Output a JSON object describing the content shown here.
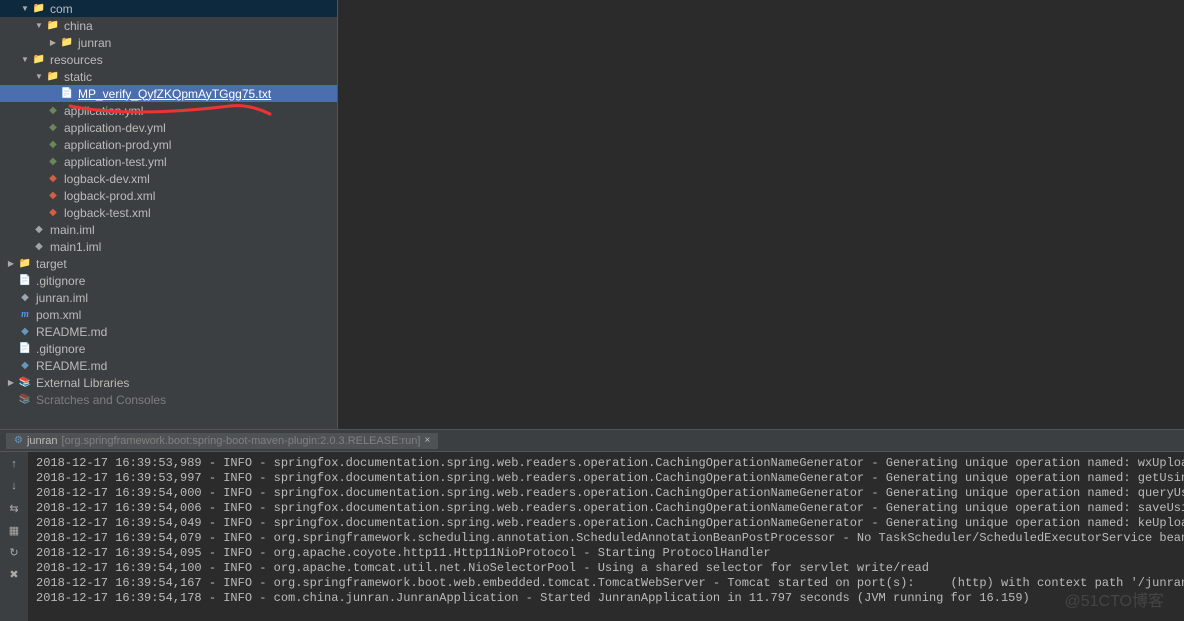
{
  "tree": [
    {
      "indent": 1,
      "arrow": "▼",
      "icon": "folder",
      "label": "com"
    },
    {
      "indent": 2,
      "arrow": "▼",
      "icon": "folder",
      "label": "china"
    },
    {
      "indent": 3,
      "arrow": "▶",
      "icon": "folder",
      "label": "junran"
    },
    {
      "indent": 1,
      "arrow": "▼",
      "icon": "folder-res",
      "label": "resources"
    },
    {
      "indent": 2,
      "arrow": "▼",
      "icon": "folder",
      "label": "static"
    },
    {
      "indent": 3,
      "arrow": "",
      "icon": "file",
      "label": "MP_verify_QyfZKQpmAyTGgg75.txt",
      "selected": true
    },
    {
      "indent": 2,
      "arrow": "",
      "icon": "yml",
      "label": "application.yml"
    },
    {
      "indent": 2,
      "arrow": "",
      "icon": "yml",
      "label": "application-dev.yml"
    },
    {
      "indent": 2,
      "arrow": "",
      "icon": "yml",
      "label": "application-prod.yml"
    },
    {
      "indent": 2,
      "arrow": "",
      "icon": "yml",
      "label": "application-test.yml"
    },
    {
      "indent": 2,
      "arrow": "",
      "icon": "xml",
      "label": "logback-dev.xml"
    },
    {
      "indent": 2,
      "arrow": "",
      "icon": "xml",
      "label": "logback-prod.xml"
    },
    {
      "indent": 2,
      "arrow": "",
      "icon": "xml",
      "label": "logback-test.xml"
    },
    {
      "indent": 1,
      "arrow": "",
      "icon": "iml",
      "label": "main.iml"
    },
    {
      "indent": 1,
      "arrow": "",
      "icon": "iml",
      "label": "main1.iml"
    },
    {
      "indent": 0,
      "arrow": "▶",
      "icon": "folder-target",
      "label": "target"
    },
    {
      "indent": 0,
      "arrow": "",
      "icon": "file",
      "label": ".gitignore"
    },
    {
      "indent": 0,
      "arrow": "",
      "icon": "iml",
      "label": "junran.iml"
    },
    {
      "indent": 0,
      "arrow": "",
      "icon": "m",
      "label": "pom.xml"
    },
    {
      "indent": 0,
      "arrow": "",
      "icon": "md",
      "label": "README.md"
    },
    {
      "indent": 0,
      "arrow": "",
      "icon": "file",
      "label": ".gitignore",
      "noindent": true
    },
    {
      "indent": 0,
      "arrow": "",
      "icon": "md",
      "label": "README.md",
      "noindent": true
    },
    {
      "indent": 0,
      "arrow": "▶",
      "icon": "ext",
      "label": "External Libraries",
      "noindent": true
    },
    {
      "indent": 0,
      "arrow": "",
      "icon": "ext",
      "label": "Scratches and Consoles",
      "noindent": true,
      "cut": true
    }
  ],
  "consoleTab": {
    "name": "junran",
    "detail": "[org.springframework.boot:spring-boot-maven-plugin:2.0.3.RELEASE:run]"
  },
  "logs": [
    "2018-12-17 16:39:53,989 - INFO - springfox.documentation.spring.web.readers.operation.CachingOperationNameGenerator - Generating unique operation named: wxUploadUsin",
    "2018-12-17 16:39:53,997 - INFO - springfox.documentation.spring.web.readers.operation.CachingOperationNameGenerator - Generating unique operation named: getUsingGET_",
    "2018-12-17 16:39:54,000 - INFO - springfox.documentation.spring.web.readers.operation.CachingOperationNameGenerator - Generating unique operation named: queryUsingGE",
    "2018-12-17 16:39:54,006 - INFO - springfox.documentation.spring.web.readers.operation.CachingOperationNameGenerator - Generating unique operation named: saveUsingPOS",
    "2018-12-17 16:39:54,049 - INFO - springfox.documentation.spring.web.readers.operation.CachingOperationNameGenerator - Generating unique operation named: keUploadUsin",
    "2018-12-17 16:39:54,079 - INFO - org.springframework.scheduling.annotation.ScheduledAnnotationBeanPostProcessor - No TaskScheduler/ScheduledExecutorService bean foun",
    "2018-12-17 16:39:54,095 - INFO - org.apache.coyote.http11.Http11NioProtocol - Starting ProtocolHandler              ",
    "2018-12-17 16:39:54,100 - INFO - org.apache.tomcat.util.net.NioSelectorPool - Using a shared selector for servlet write/read",
    "2018-12-17 16:39:54,167 - INFO - org.springframework.boot.web.embedded.tomcat.TomcatWebServer - Tomcat started on port(s):     (http) with context path '/junran'",
    "2018-12-17 16:39:54,178 - INFO - com.china.junran.JunranApplication - Started JunranApplication in 11.797 seconds (JVM running for 16.159)"
  ],
  "gutterButtons": [
    "↑",
    "↓",
    "⇆",
    "▦",
    "↻",
    "✖"
  ],
  "watermark": "@51CTO博客"
}
